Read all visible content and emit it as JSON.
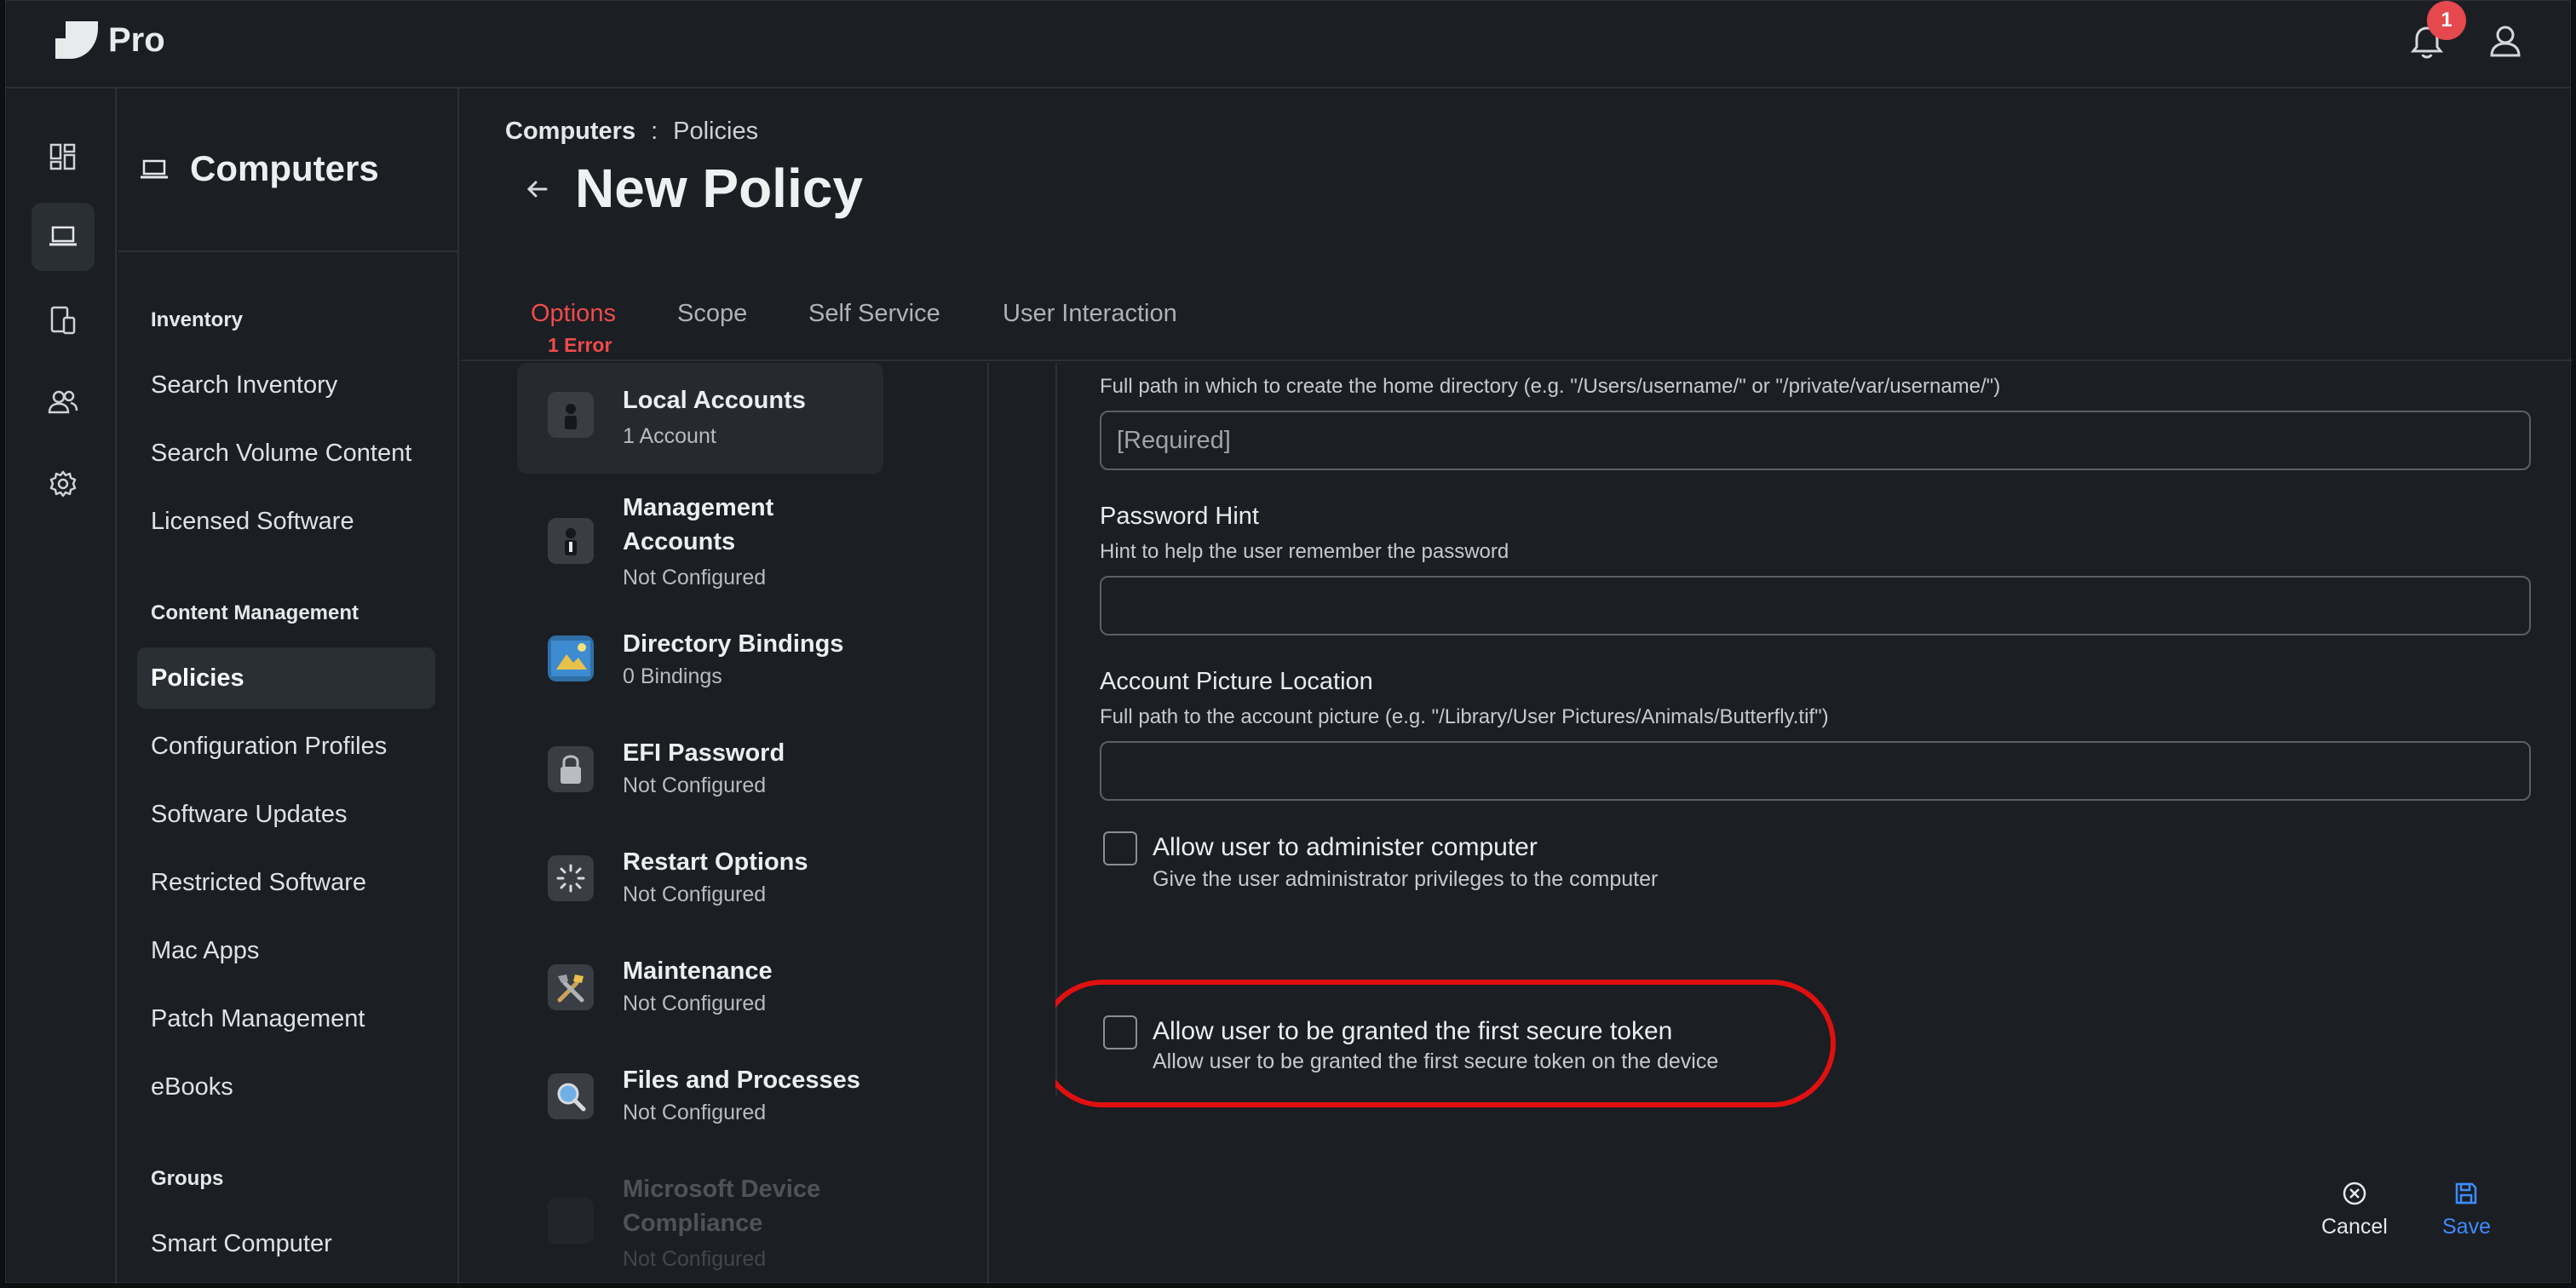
{
  "app": {
    "name": "Pro",
    "notifications_count": "1"
  },
  "nav": {
    "title": "Computers",
    "sections": [
      {
        "heading": "Inventory",
        "items": [
          "Search Inventory",
          "Search Volume Content",
          "Licensed Software"
        ]
      },
      {
        "heading": "Content Management",
        "items": [
          "Policies",
          "Configuration Profiles",
          "Software Updates",
          "Restricted Software",
          "Mac Apps",
          "Patch Management",
          "eBooks"
        ]
      },
      {
        "heading": "Groups",
        "items": [
          "Smart Computer"
        ]
      }
    ],
    "active_item": "Policies"
  },
  "breadcrumb": {
    "parent": "Computers",
    "separator": ":",
    "current": "Policies"
  },
  "page_title": "New Policy",
  "tabs": [
    {
      "label": "Options",
      "error": "1 Error",
      "active": true
    },
    {
      "label": "Scope"
    },
    {
      "label": "Self Service"
    },
    {
      "label": "User Interaction"
    }
  ],
  "payloads": [
    {
      "name": "Local Accounts",
      "sub": "1 Account",
      "active": true
    },
    {
      "name": "Management Accounts",
      "sub": "Not Configured"
    },
    {
      "name": "Directory Bindings",
      "sub": "0 Bindings"
    },
    {
      "name": "EFI Password",
      "sub": "Not Configured"
    },
    {
      "name": "Restart Options",
      "sub": "Not Configured"
    },
    {
      "name": "Maintenance",
      "sub": "Not Configured"
    },
    {
      "name": "Files and Processes",
      "sub": "Not Configured"
    },
    {
      "name": "Microsoft Device Compliance",
      "sub": "Not Configured"
    }
  ],
  "form": {
    "home_dir": {
      "help": "Full path in which to create the home directory (e.g. \"/Users/username/\" or \"/private/var/username/\")",
      "placeholder": "[Required]",
      "value": ""
    },
    "password_hint": {
      "label": "Password Hint",
      "help": "Hint to help the user remember the password",
      "value": ""
    },
    "account_picture": {
      "label": "Account Picture Location",
      "help": "Full path to the account picture (e.g. \"/Library/User Pictures/Animals/Butterfly.tif\")",
      "value": ""
    },
    "admin": {
      "label": "Allow user to administer computer",
      "help": "Give the user administrator privileges to the computer",
      "checked": false
    },
    "secure_token": {
      "label": "Allow user to be granted the first secure token",
      "help": "Allow user to be granted the first secure token on the device",
      "checked": false
    }
  },
  "actions": {
    "cancel": "Cancel",
    "save": "Save"
  },
  "colors": {
    "accent_error": "#ef4b4b",
    "save_blue": "#3d8bff",
    "highlight_ring": "#e01010"
  }
}
